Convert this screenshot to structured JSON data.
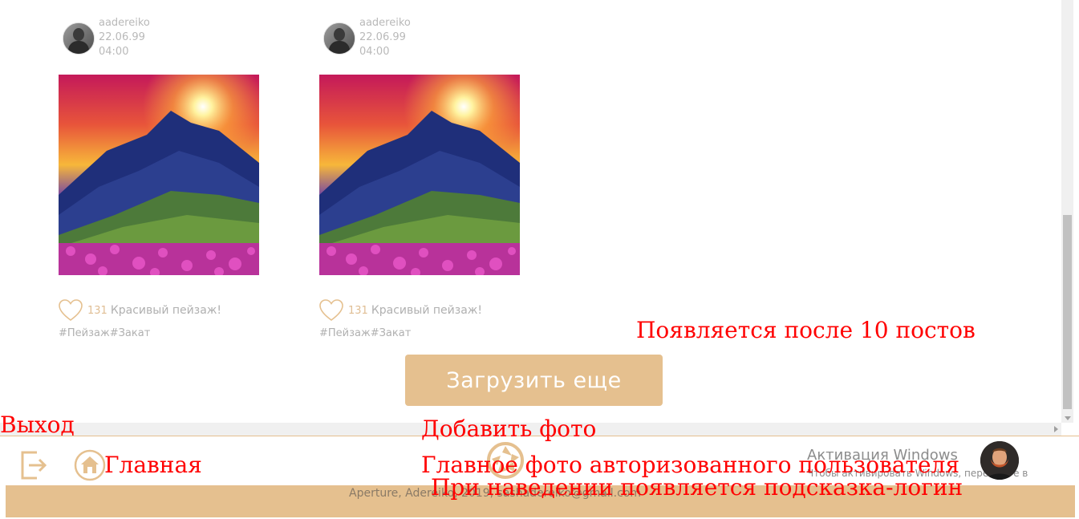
{
  "posts": [
    {
      "author": "aadereiko",
      "date": "22.06.99",
      "time": "04:00",
      "likes": "131",
      "caption": "Красивый пейзаж!",
      "tags": "#Пейзаж#Закат"
    },
    {
      "author": "aadereiko",
      "date": "22.06.99",
      "time": "04:00",
      "likes": "131",
      "caption": "Красивый пейзаж!",
      "tags": "#Пейзаж#Закат"
    }
  ],
  "load_more": {
    "label": "Загрузить еще"
  },
  "footer": {
    "copyright": "Aperture, Adereiko, 2019, sashadereiko@gmail.com"
  },
  "windows_watermark": {
    "title": "Активация Windows",
    "subtitle": "Чтобы активировать Windows, перейдите в"
  },
  "annotations": {
    "after_posts": "Появляется после 10 постов",
    "logout": "Выход",
    "home": "Главная",
    "add_photo": "Добавить фото",
    "user_photo": "Главное фото авторизованного пользователя",
    "hover_hint": "При наведении появляется подсказка-логин"
  },
  "colors": {
    "accent": "#e5c08f",
    "annotation": "#ff0000"
  },
  "icons": {
    "logout": "logout-icon",
    "home": "home-icon",
    "add_photo": "aperture-icon",
    "like": "heart-icon"
  }
}
